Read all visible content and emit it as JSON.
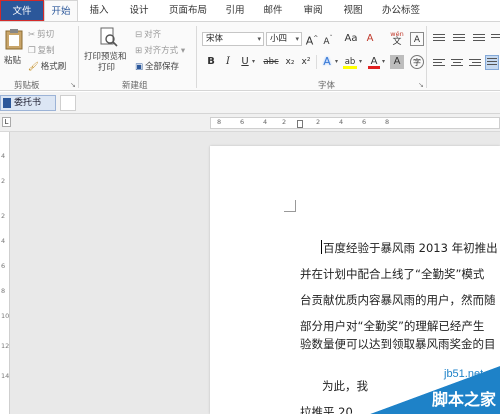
{
  "tabs": {
    "file": "文件",
    "home": "开始",
    "insert": "插入",
    "design": "设计",
    "layout": "页面布局",
    "references": "引用",
    "mailings": "邮件",
    "review": "审阅",
    "view": "视图",
    "office_tab": "办公标签"
  },
  "clipboard": {
    "paste": "粘贴",
    "cut": "剪切",
    "copy": "复制",
    "format_painter": "格式刷",
    "group_label": "剪贴板"
  },
  "newgroup": {
    "print_preview_line1": "打印预览和",
    "print_preview_line2": "打印",
    "align": "对齐",
    "align_mode": "对齐方式",
    "save_all": "全部保存",
    "group_label": "新建组"
  },
  "font": {
    "font_name": "宋体",
    "font_size": "小四",
    "bold": "B",
    "italic": "I",
    "underline": "U",
    "strike": "abc",
    "subscript": "x₂",
    "superscript": "x²",
    "group_label": "字体",
    "grow": "A",
    "shrink": "A",
    "change_case": "Aa",
    "clear_format": "A",
    "phonetic": "wén",
    "text_effect": "A",
    "highlight": "ab",
    "font_color": "A",
    "char_shading": "A"
  },
  "document": {
    "tab_title": "委托书",
    "ruler_ticks": [
      "8",
      "6",
      "4",
      "2",
      "2",
      "4",
      "6",
      "8"
    ],
    "vruler_ticks": [
      "4",
      "2",
      "2",
      "4",
      "6",
      "8",
      "10",
      "12",
      "14"
    ],
    "paragraphs": [
      "百度经验于暴风雨 2013 年初推出",
      "并在计划中配合上线了“全勤奖”模式",
      "台贡献优质内容暴风雨的用户，然而随",
      "部分用户对“全勤奖”的理解已经产生",
      "验数量便可以达到领取暴风雨奖金的目",
      "为此，我",
      "拉推平 20"
    ]
  },
  "watermark": {
    "line1": "jb51.net",
    "line2": "脚本之家"
  },
  "colors": {
    "accent": "#2b579a",
    "file_tab_border": "#d32a2a",
    "watermark_blue": "#1e82c8"
  }
}
